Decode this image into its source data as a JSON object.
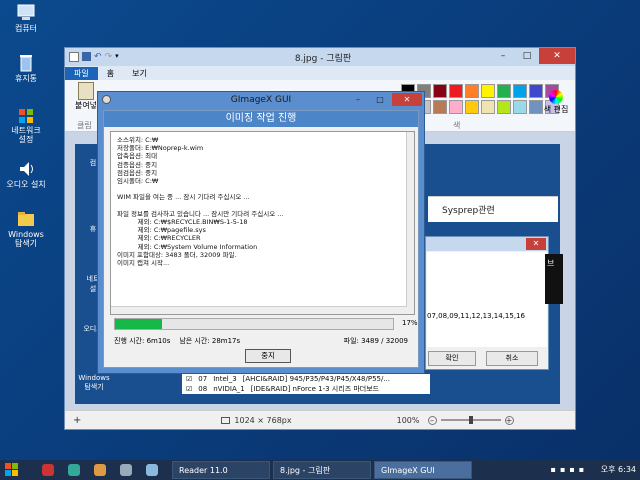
{
  "desktop": {
    "icons": [
      {
        "label": "컴퓨터",
        "icon": "computer-icon"
      },
      {
        "label": "휴지통",
        "icon": "recycle-bin-icon"
      },
      {
        "label": "네트워크",
        "label2": "설정",
        "icon": "network-icon"
      },
      {
        "label": "오디오 설치",
        "icon": "speaker-icon"
      },
      {
        "label": "Windows",
        "label2": "탐색기",
        "icon": "folder-icon"
      }
    ],
    "inner_icons": [
      {
        "label": "컴"
      },
      {
        "label": "휴"
      },
      {
        "label": "네트",
        "label2": "설"
      },
      {
        "label": "오디오"
      },
      {
        "label": "Windows",
        "label2": "탐색기"
      }
    ]
  },
  "paint": {
    "title": "8.jpg - 그림판",
    "tabs": [
      "파일",
      "홈",
      "보기"
    ],
    "ribbon_left": "붙여넣",
    "ribbon_left2": "클립",
    "edit_colors_label": "색 편집",
    "colors_group_label": "색",
    "palette": [
      "#000000",
      "#7f7f7f",
      "#880015",
      "#ed1c24",
      "#ff7f27",
      "#fff200",
      "#22b14c",
      "#00a2e8",
      "#3f48cc",
      "#a349a4",
      "#ffffff",
      "#c3c3c3",
      "#b97a57",
      "#ffaec9",
      "#ffc90e",
      "#efe4b0",
      "#b5e61d",
      "#99d9ea",
      "#7092be",
      "#c8bfe7"
    ],
    "status": {
      "add": "+",
      "size": "1024 × 768px",
      "zoom": "100%"
    },
    "canvas_rows": [
      {
        "num": "07",
        "name": "Intel_3",
        "desc": "[AHCI&RAID] 945/P35/P43/P45/X48/P55/..."
      },
      {
        "num": "08",
        "name": "nVIDIA_1",
        "desc": "[IDE&RAID] nForce 1-3 시리즈 마더보드"
      }
    ],
    "sysprep_label": "Sysprep관련",
    "dialog": {
      "numbers": "07,08,09,11,12,13,14,15,16",
      "ok": "확인",
      "cancel": "취소",
      "side": "브"
    }
  },
  "gimagex": {
    "title": "GImageX GUI",
    "heading": "이미징 작업 진행",
    "log_lines": [
      "소스위치: C:₩",
      "저장폴더: E:₩Noprep-k.wim",
      "압축옵션: 최대",
      "검증옵션: 중지",
      "점검옵션: 중지",
      "임시폴더: C:₩",
      "",
      "WIM 파일을 여는 중 ... 잠시 기다려 주십시오 ...",
      "",
      "파일 정보를 검사하고 있습니다 ... 잠시만 기다려 주십시오 ...",
      "          제외: C:₩$RECYCLE.BIN₩S-1-5-18",
      "          제외: C:₩pagefile.sys",
      "          제외: C:₩RECYCLER",
      "          제외: C:₩System Volume Information",
      "이미지 포함대상: 3483 폴더, 32009 파일.",
      "이미지 캡쳐 시작..."
    ],
    "progress_percent": 17,
    "progress_label": "17%",
    "elapsed": "진행 시간: 6m10s",
    "remaining": "남은 시간: 28m17s",
    "files": "파일: 3489 / 32009",
    "stop_label": "중지"
  },
  "taskbar": {
    "items": [
      {
        "label": "Reader 11.0",
        "active": false
      },
      {
        "label": "8.jpg - 그림판",
        "active": false
      },
      {
        "label": "GImageX GUI",
        "active": true
      }
    ],
    "clock": "오후 6:34"
  },
  "colors": {
    "accent": "#4d86c8",
    "progress": "#16b84a",
    "close": "#c7413a"
  }
}
